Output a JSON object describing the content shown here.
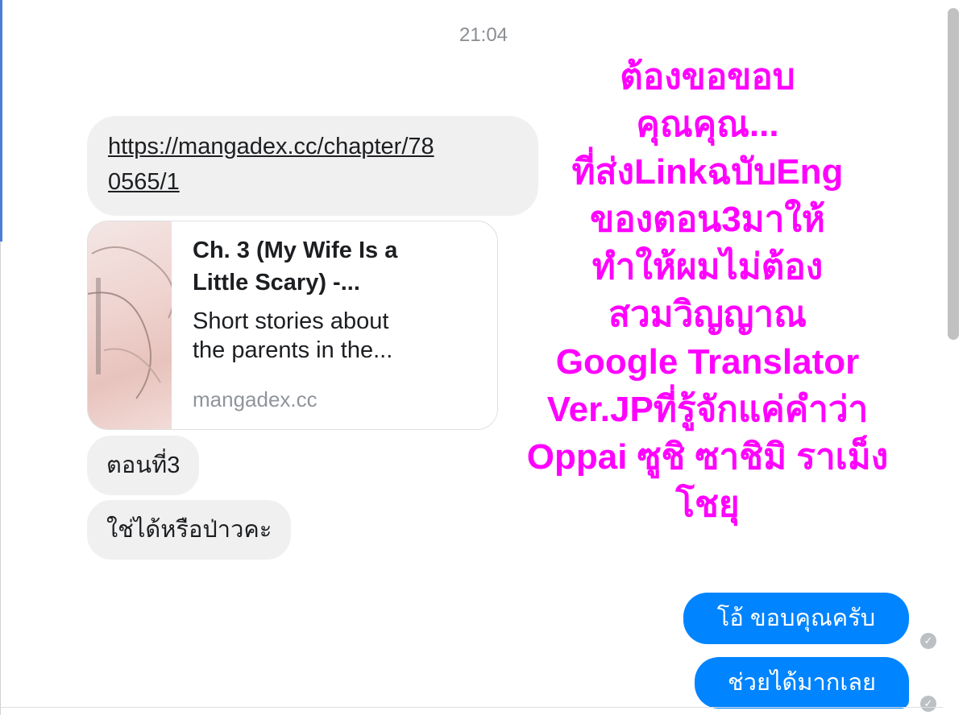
{
  "conversation": {
    "timestamp": "21:04",
    "received": {
      "link_url": "https://mangadex.cc/chapter/780565/1",
      "link_line1": "https://mangadex.cc/chapter/78",
      "link_line2": "0565/1",
      "preview": {
        "title_line1": "Ch. 3 (My Wife Is a",
        "title_line2": "Little Scary) -...",
        "desc_line1": "Short stories about",
        "desc_line2": "the parents in the...",
        "domain": "mangadex.cc"
      },
      "message_3": "ตอนที่3",
      "message_4": "ใช่ได้หรือป่าวคะ"
    },
    "sent": {
      "message_1": "โอ้ ขอบคุณครับ",
      "message_2": "ช่วยได้มากเลย"
    }
  },
  "overlay_text": {
    "line1": "ต้องขอขอบ",
    "line2": "คุณคุณ...",
    "line3": "ที่ส่งLinkฉบับEng",
    "line4": "ของตอน3มาให้",
    "line5": "ทำให้ผมไม่ต้อง",
    "line6": "สวมวิญญาณ",
    "line7": "Google Translator",
    "line8": "Ver.JPที่รู้จักแค่คำว่า",
    "line9": "Oppai ซูชิ ซาชิมิ ราเม็ง",
    "line10": "โชยุ"
  },
  "colors": {
    "overlay": "#ff00ff",
    "sent_bubble": "#0084ff",
    "received_bubble": "#f0f0f0"
  },
  "icons": {
    "read_receipt": "check-circle-icon"
  }
}
